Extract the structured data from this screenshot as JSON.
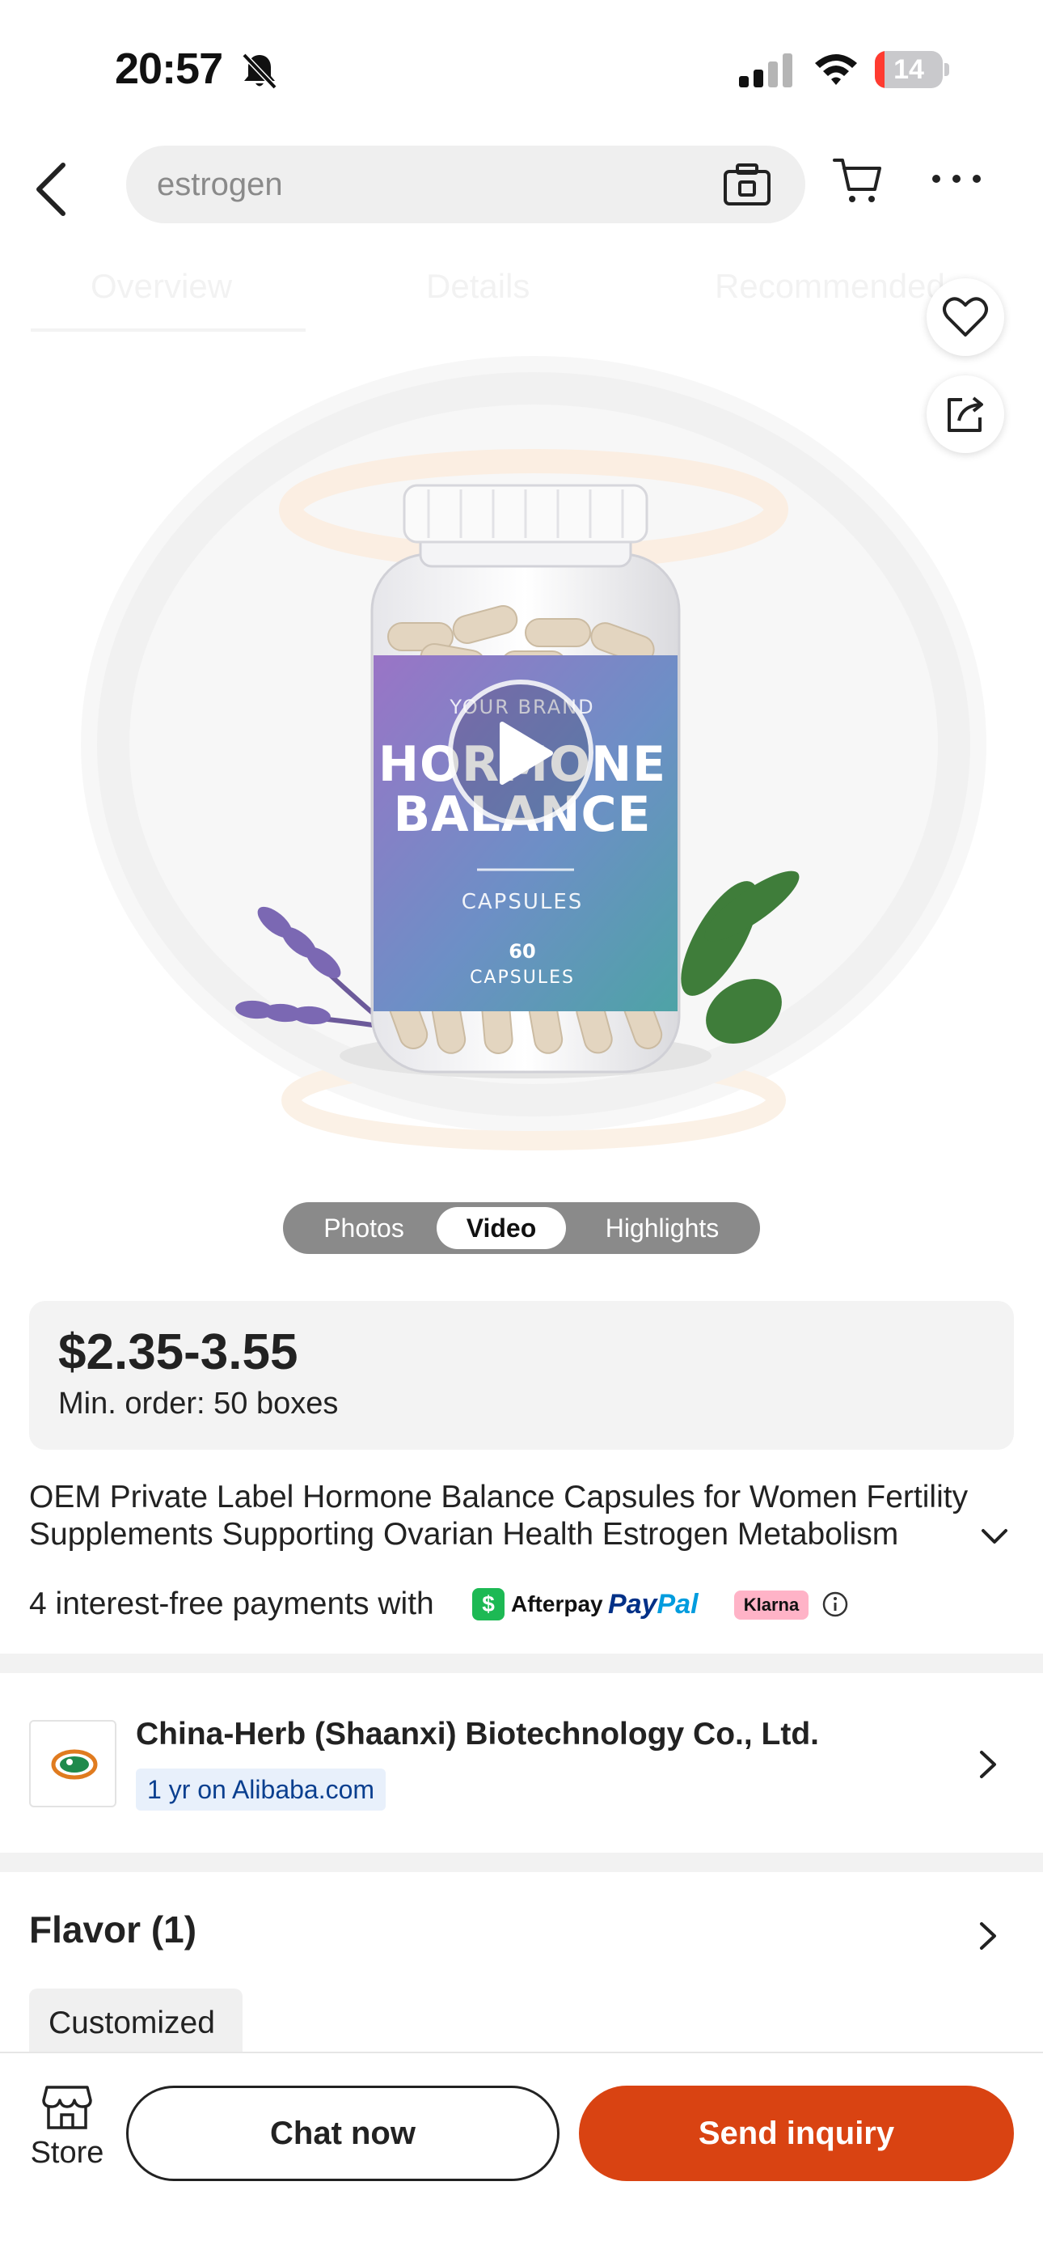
{
  "status_bar": {
    "time": "20:57",
    "battery_level": "14",
    "battery_fraction": 0.14,
    "icons": [
      "bell-slash-icon",
      "signal-icon",
      "wifi-icon",
      "battery-icon"
    ]
  },
  "header": {
    "search_text": "estrogen",
    "icons": [
      "back-icon",
      "camera-icon",
      "cart-icon",
      "more-icon"
    ]
  },
  "section_tabs": [
    "Overview",
    "Details",
    "Recommended"
  ],
  "media": {
    "product_image": {
      "brand": "YOUR BRAND",
      "title_line1": "HORMONE",
      "title_line2": "BALANCE",
      "subtitle": "CAPSULES",
      "count": "60",
      "count_label": "CAPSULES"
    },
    "switch": [
      "Photos",
      "Video",
      "Highlights"
    ],
    "selected_switch": "Video",
    "icons": [
      "heart-icon",
      "share-icon",
      "play-icon"
    ]
  },
  "price_card": {
    "price": "$2.35-3.55",
    "min_order": "Min. order: 50 boxes"
  },
  "product_title": "OEM Private Label Hormone Balance Capsules for Women Fertility Supplements Supporting Ovarian Health Estrogen Metabolism",
  "payments": {
    "text": "4 interest-free payments with",
    "afterpay_mark": "$",
    "afterpay": "Afterpay",
    "paypal_1": "Pay",
    "paypal_2": "Pal",
    "klarna": "Klarna"
  },
  "supplier": {
    "name": "China-Herb (Shaanxi) Biotechnology Co., Ltd.",
    "badge": "1 yr on Alibaba.com"
  },
  "flavor": {
    "title": "Flavor (1)",
    "options": [
      "Customized"
    ]
  },
  "bottom_bar": {
    "store_label": "Store",
    "chat_label": "Chat now",
    "inquiry_label": "Send inquiry"
  },
  "colors": {
    "accent": "#d94312",
    "badge_bg": "#e8f0fb",
    "badge_text": "#0a3f8f"
  }
}
